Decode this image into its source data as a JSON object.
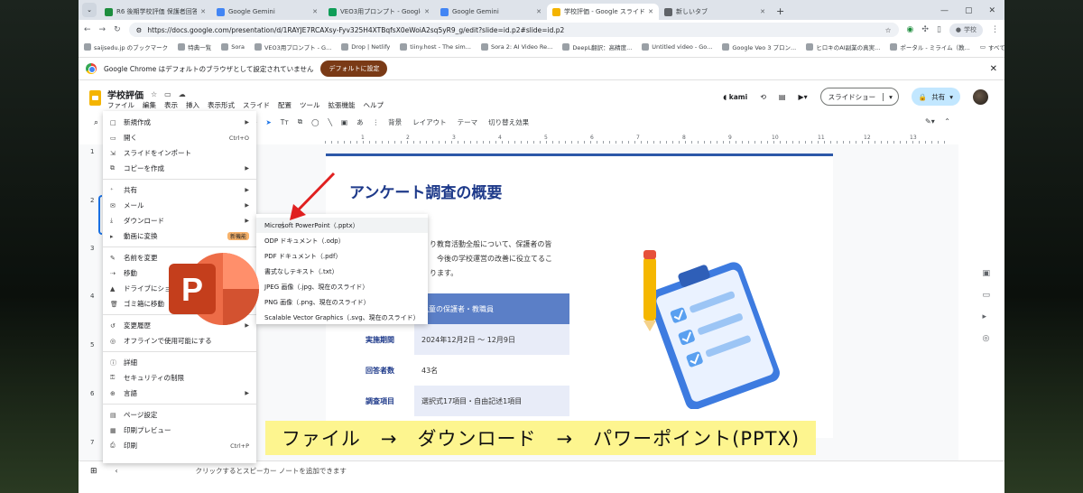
{
  "browser": {
    "tabs": [
      {
        "title": "R6 後期学校評価 保護者回答",
        "active": false,
        "favicon_color": "#1e8e3e"
      },
      {
        "title": "Google Gemini",
        "active": false,
        "favicon_color": "#4285f4"
      },
      {
        "title": "VEO3用プロンプト - Google スプレ",
        "active": false,
        "favicon_color": "#0f9d58"
      },
      {
        "title": "Google Gemini",
        "active": false,
        "favicon_color": "#4285f4"
      },
      {
        "title": "学校評価 - Google スライド",
        "active": true,
        "favicon_color": "#f4b400"
      },
      {
        "title": "新しいタブ",
        "active": false,
        "favicon_color": "#5f6368"
      }
    ],
    "url": "https://docs.google.com/presentation/d/1RAYJE7RCAXsy-Fyv325H4XTBqfsX0eWoiA2sq5yR9_g/edit?slide=id.p2#slide=id.p2",
    "profile_label": "学校",
    "bookmarks": [
      "saijsedu.jp のブックマーク",
      "特典一覧",
      "Sora",
      "VEO3用プロンプト - G...",
      "Drop | Netlify",
      "tiiny.host - The sim...",
      "Sora 2: AI Video Re...",
      "DeepL翻訳：高精度...",
      "Untitled video - Go...",
      "Google Veo 3 プロン...",
      "ヒロキのAI副業の真実...",
      "ポータル - ミライム（教..."
    ],
    "bookmarks_all": "すべてのブックマーク",
    "infobar_text": "Google Chrome はデフォルトのブラウザとして設定されていません",
    "infobar_button": "デフォルトに設定"
  },
  "app": {
    "doc_title": "学校評価",
    "menus": [
      "ファイル",
      "編集",
      "表示",
      "挿入",
      "表示形式",
      "スライド",
      "配置",
      "ツール",
      "拡張機能",
      "ヘルプ"
    ],
    "kami": "kami",
    "slideshow_label": "スライドショー",
    "share_label": "共有",
    "toolbar": [
      "背景",
      "レイアウト",
      "テーマ",
      "切り替え効果"
    ],
    "zoom_label": "ｷｰ",
    "slide_numbers": [
      "1",
      "2",
      "3",
      "4",
      "5",
      "6",
      "7"
    ],
    "notes_hint": "クリックするとスピーカー ノートを追加できます"
  },
  "file_menu": {
    "items": [
      {
        "icon": "□",
        "label": "新規作成",
        "arrow": true
      },
      {
        "icon": "▭",
        "label": "開く",
        "shortcut": "Ctrl+O"
      },
      {
        "icon": "⇲",
        "label": "スライドをインポート"
      },
      {
        "icon": "⧉",
        "label": "コピーを作成",
        "arrow": true
      },
      {
        "sep": true
      },
      {
        "icon": "⁺",
        "label": "共有",
        "arrow": true
      },
      {
        "icon": "✉",
        "label": "メール",
        "arrow": true
      },
      {
        "icon": "⤓",
        "label": "ダウンロード",
        "arrow": true
      },
      {
        "icon": "▸",
        "label": "動画に変換",
        "badge": "新機能"
      },
      {
        "sep": true
      },
      {
        "icon": "✎",
        "label": "名前を変更"
      },
      {
        "icon": "⇢",
        "label": "移動"
      },
      {
        "icon": "▲",
        "label": "ドライブにショー"
      },
      {
        "icon": "🗑",
        "label": "ゴミ箱に移動"
      },
      {
        "sep": true
      },
      {
        "icon": "↺",
        "label": "変更履歴",
        "arrow": true
      },
      {
        "icon": "◎",
        "label": "オフラインで使用可能にする"
      },
      {
        "sep": true
      },
      {
        "icon": "ⓘ",
        "label": "詳細"
      },
      {
        "icon": "⚿",
        "label": "セキュリティの制限"
      },
      {
        "icon": "⊕",
        "label": "言語",
        "arrow": true
      },
      {
        "sep": true
      },
      {
        "icon": "▤",
        "label": "ページ設定"
      },
      {
        "icon": "▦",
        "label": "印刷プレビュー"
      },
      {
        "icon": "⎙",
        "label": "印刷",
        "shortcut": "Ctrl+P"
      }
    ]
  },
  "download_menu": {
    "items": [
      "Microsoft PowerPoint（.pptx）",
      "ODP ドキュメント（.odp）",
      "PDF ドキュメント（.pdf）",
      "書式なしテキスト（.txt）",
      "JPEG 画像（.jpg、現在のスライド）",
      "PNG 画像（.png、現在のスライド）",
      "Scalable Vector Graphics（.svg、現在のスライド）"
    ],
    "hovered_index": 0
  },
  "slide": {
    "title": "アンケート調査の概要",
    "body_lines": [
      "り教育活動全般について、保護者の皆",
      "　今後の学校運営の改善に役立てるこ",
      "ります。"
    ],
    "table": [
      {
        "key": "",
        "value": "児童の保護者・教職員"
      },
      {
        "key": "実施期間",
        "value": "2024年12月2日 ～ 12月9日"
      },
      {
        "key": "回答者数",
        "value": "43名"
      },
      {
        "key": "調査項目",
        "value": "選択式17項目・自由記述1項目"
      }
    ]
  },
  "overlay": {
    "caption": "ファイル　→　ダウンロード　→　パワーポイント(PPTX)",
    "ppt_letter": "P"
  },
  "colors": {
    "slide_title": "#1e3a8a",
    "accent_blue": "#1a73e8",
    "ppt_red": "#c43e1c",
    "caption_bg": "#fdf58f"
  }
}
